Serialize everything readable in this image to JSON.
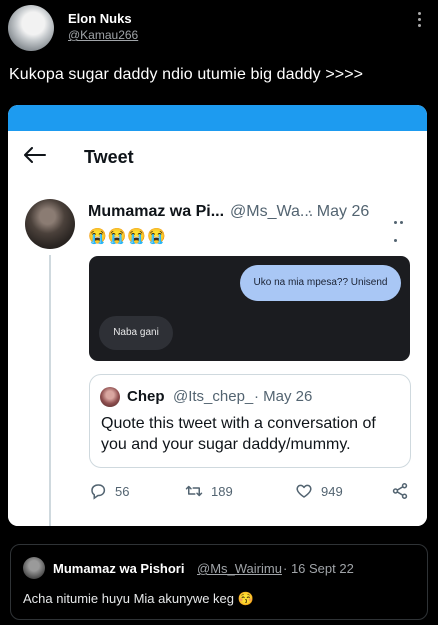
{
  "outer_tweet": {
    "author_name": "Elon Nuks",
    "author_handle": "@Kamau266",
    "text": "Kukopa sugar daddy ndio utumie  big daddy >>>>"
  },
  "screenshot": {
    "header_title": "Tweet",
    "tweet": {
      "author_name": "Mumamaz wa Pi...",
      "author_handle": "@Ms_Wa...",
      "date": "· May 26",
      "emojis": "😭😭😭😭"
    },
    "chat": {
      "outgoing": "Uko na mia mpesa?? Unisend",
      "incoming": "Naba gani"
    },
    "quoted": {
      "name": "Chep",
      "handle": "@Its_chep_",
      "date": "· May 26",
      "text": "Quote this tweet with a conversation of you and your sugar daddy/mummy."
    },
    "actions": {
      "replies": "56",
      "retweets": "189",
      "likes": "949"
    }
  },
  "quoted_tweet": {
    "name": "Mumamaz wa Pishori",
    "handle": "@Ms_Wairimu",
    "date": "· 16 Sept 22",
    "text": "Acha nitumie huyu Mia akunywe keg 😚"
  },
  "colors": {
    "background": "#000000",
    "accent_blue": "#1d9bf0",
    "chat_outgoing": "#a9c7f5",
    "chat_bg": "#1b1c20"
  }
}
